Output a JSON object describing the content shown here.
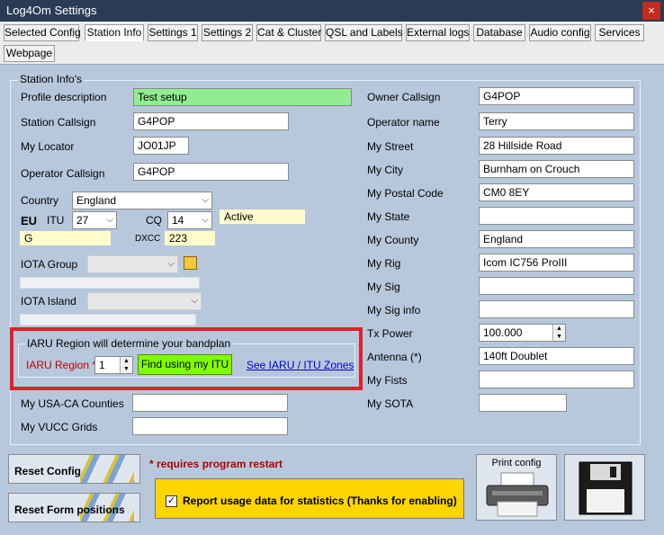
{
  "window": {
    "title": "Log4Om Settings",
    "close_glyph": "×"
  },
  "tabs": [
    "Selected Config",
    "Station Info",
    "Settings 1",
    "Settings 2",
    "Cat & Cluster",
    "QSL and Labels",
    "External logs",
    "Database",
    "Audio config",
    "Services",
    "Webpage"
  ],
  "group_title": "Station Info's",
  "left": {
    "profile_label": "Profile description",
    "profile_value": "Test setup",
    "callsign_label": "Station Callsign",
    "callsign_value": "G4POP",
    "locator_label": "My Locator",
    "locator_value": "JO01JP",
    "opcall_label": "Operator Callsign",
    "opcall_value": "G4POP",
    "country_label": "Country",
    "country_value": "England",
    "continent": "EU",
    "itu_label": "ITU",
    "itu_value": "27",
    "cq_label": "CQ",
    "cq_value": "14",
    "status": "Active",
    "prefix": "G",
    "dxcc_label": "DXCC",
    "dxcc_value": "223",
    "iota_group_label": "IOTA Group",
    "iota_island_label": "IOTA Island",
    "usaca_label": "My USA-CA Counties",
    "vucc_label": "My VUCC Grids"
  },
  "iaru": {
    "title": "IARU Region will determine your bandplan",
    "label": "IARU Region *",
    "value": "1",
    "find_button": "Find using my ITU",
    "link": "See IARU / ITU Zones"
  },
  "right": {
    "owner_label": "Owner Callsign",
    "owner_value": "G4POP",
    "opname_label": "Operator name",
    "opname_value": "Terry",
    "street_label": "My Street",
    "street_value": "28 Hillside Road",
    "city_label": "My City",
    "city_value": "Burnham on Crouch",
    "postal_label": "My Postal Code",
    "postal_value": "CM0 8EY",
    "state_label": "My State",
    "county_label": "My County",
    "county_value": "England",
    "rig_label": "My Rig",
    "rig_value": "Icom IC756 ProIII",
    "sig_label": "My Sig",
    "siginfo_label": "My Sig info",
    "txpower_label": "Tx Power",
    "txpower_value": "100.000",
    "antenna_label": "Antenna (*)",
    "antenna_value": "140ft Doublet",
    "fists_label": "My Fists",
    "sota_label": "My SOTA"
  },
  "footer": {
    "reset_config": "Reset Config",
    "reset_form": "Reset Form positions",
    "restart_note": "* requires program restart",
    "report_label": "Report usage data for statistics (Thanks for enabling)",
    "check_glyph": "✓",
    "print_label": "Print config"
  },
  "colors": {
    "accent_green": "#90ee90",
    "iaru_border": "#e0202a",
    "report_bg": "#ffd500"
  }
}
